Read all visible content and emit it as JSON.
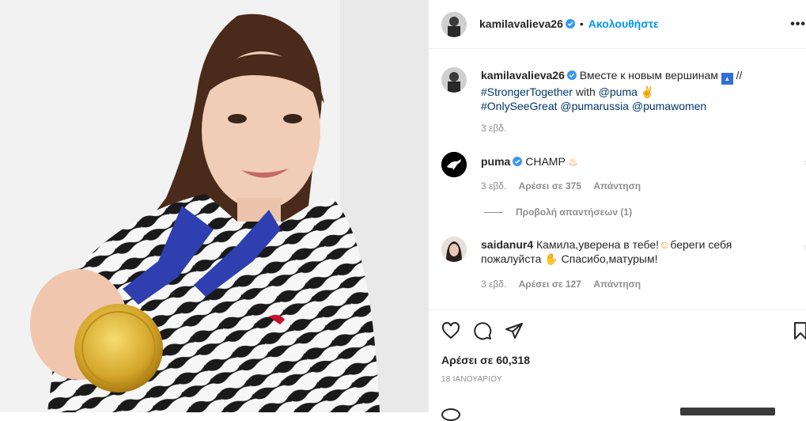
{
  "post": {
    "username": "kamilavalieva26",
    "follow_label": "Ακολουθήστε",
    "more_label": "•••"
  },
  "caption": {
    "username": "kamilavalieva26",
    "text_part1": "Вместе к новым вершинам",
    "separator": "//",
    "tag1": "#StrongerTogether",
    "with_label": "with",
    "mention1": "@puma",
    "tag2": "#OnlySeeGreat",
    "mention2": "@pumarussia",
    "mention3": "@pumawomen",
    "time": "3 εβδ."
  },
  "comments": [
    {
      "username": "puma",
      "text": "CHAMP",
      "time": "3 εβδ.",
      "likes": "Αρέσει σε 375",
      "reply_label": "Απάντηση",
      "view_replies": "Προβολή απαντήσεων (1)"
    },
    {
      "username": "saidanur4",
      "text_line1": "Камила,уверена в тебе!",
      "text_line1b": "береги себя",
      "text_line2": "пожалуйста",
      "text_line2b": "Спасибо,матурым!",
      "time": "3 εβδ.",
      "likes": "Αρέσει σε 127",
      "reply_label": "Απάντηση"
    }
  ],
  "footer": {
    "likes": "Αρέσει σε 60,318",
    "date": "18 ΙΑΝΟΥΑΡΙΟΥ"
  },
  "icons": [
    "heart-icon",
    "comment-icon",
    "share-icon",
    "bookmark-icon",
    "verified-icon",
    "more-icon"
  ],
  "colors": {
    "link": "#0095f6",
    "tag": "#00376b",
    "secondary": "#8e8e8e",
    "verified": "#3897f0"
  }
}
